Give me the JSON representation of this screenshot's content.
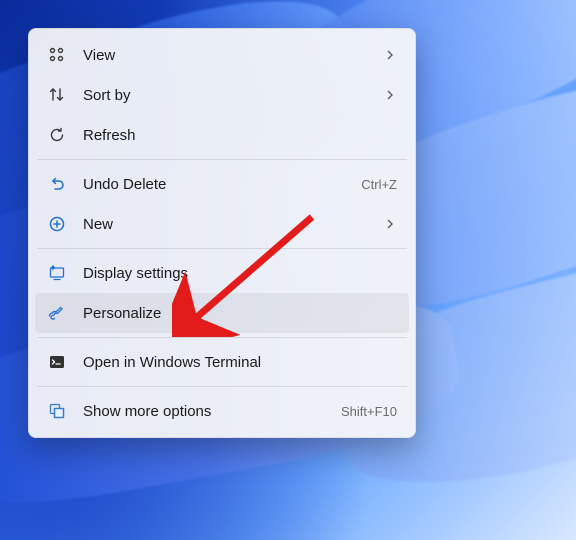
{
  "menu": {
    "view": {
      "label": "View",
      "submenu": true
    },
    "sort": {
      "label": "Sort by",
      "submenu": true
    },
    "refresh": {
      "label": "Refresh"
    },
    "undo": {
      "label": "Undo Delete",
      "accel": "Ctrl+Z"
    },
    "new": {
      "label": "New",
      "submenu": true
    },
    "display": {
      "label": "Display settings"
    },
    "personalize": {
      "label": "Personalize",
      "hover": true
    },
    "terminal": {
      "label": "Open in Windows Terminal"
    },
    "more": {
      "label": "Show more options",
      "accel": "Shift+F10"
    }
  },
  "annotation": {
    "arrow_color": "#e21b1b",
    "target": "personalize"
  }
}
